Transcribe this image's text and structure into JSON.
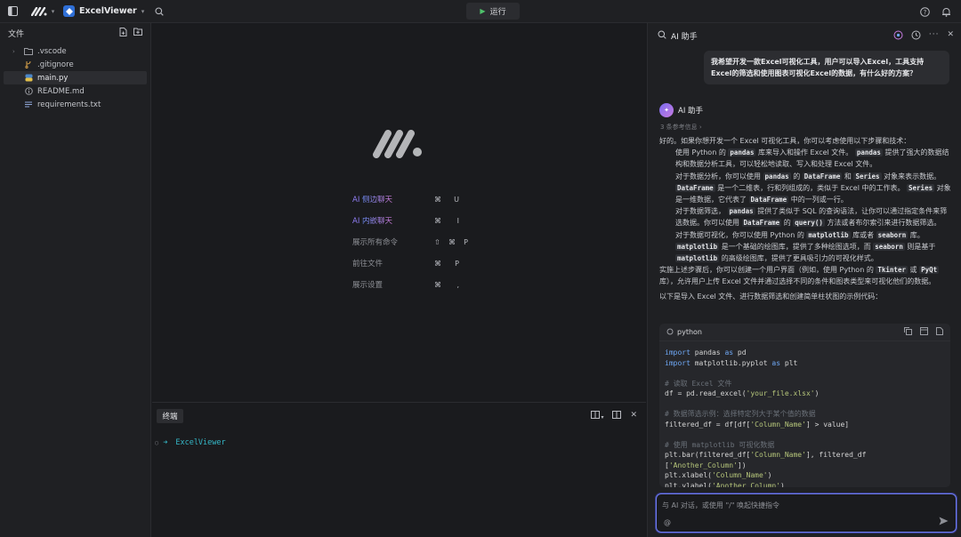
{
  "titlebar": {
    "project": "ExcelViewer",
    "run_label": "运行"
  },
  "sidebar": {
    "title": "文件",
    "items": [
      {
        "label": ".vscode",
        "kind": "folder"
      },
      {
        "label": ".gitignore",
        "kind": "git"
      },
      {
        "label": "main.py",
        "kind": "python",
        "active": true
      },
      {
        "label": "README.md",
        "kind": "info"
      },
      {
        "label": "requirements.txt",
        "kind": "text"
      }
    ]
  },
  "editor": {
    "shortcuts": [
      {
        "prefix": "AI",
        "label": "侧边聊天",
        "k1": "⌘",
        "k2": "U"
      },
      {
        "prefix": "AI",
        "label": "内嵌聊天",
        "k1": "⌘",
        "k2": "I"
      },
      {
        "prefix": "",
        "label": "展示所有命令",
        "k0": "⇧",
        "k1": "⌘",
        "k2": "P"
      },
      {
        "prefix": "",
        "label": "前往文件",
        "k1": "⌘",
        "k2": "P"
      },
      {
        "prefix": "",
        "label": "展示设置",
        "k1": "⌘",
        "k2": ","
      }
    ]
  },
  "terminal": {
    "tab_label": "终端",
    "cwd": "ExcelViewer"
  },
  "ai_panel": {
    "title": "AI 助手",
    "user_message": "我希望开发一款Excel可视化工具，用户可以导入Excel，工具支持Excel的筛选和使用图表可视化Excel的数据，有什么好的方案？",
    "bot_name": "AI 助手",
    "refs": "3 条参考信息 ›",
    "answer_intro": "好的。如果你想开发一个 Excel 可视化工具，你可以考虑使用以下步骤和技术：",
    "step1_a": "使用 Python 的",
    "step1_code": "pandas",
    "step1_b": "库来导入和操作 Excel 文件。",
    "step1_code2": "pandas",
    "step1_c": "提供了强大的数据结构和数据分析工具，可以轻松地读取、写入和处理 Excel 文件。",
    "step2_a": "对于数据分析，你可以使用",
    "step2_code": "pandas",
    "step2_b": "的",
    "step2_code2": "DataFrame",
    "step2_c": "和",
    "step2_code3": "Series",
    "step2_d": "对象来表示数据。",
    "step2_code4": "DataFrame",
    "step2_e": "是一个二维表，行和列组成的，类似于 Excel 中的工作表。",
    "step2_code5": "Series",
    "step2_f": "对象是一维数据，它代表了",
    "step2_code6": "DataFrame",
    "step2_g": "中的一列或一行。",
    "step3_a": "对于数据筛选，",
    "step3_code": "pandas",
    "step3_b": "提供了类似于 SQL 的查询语法，让你可以通过指定条件来筛选数据。你可以使用",
    "step3_code2": "DataFrame",
    "step3_c": "的",
    "step3_code3": "query()",
    "step3_d": "方法或者布尔索引来进行数据筛选。",
    "step4_a": "对于数据可视化，你可以使用 Python 的",
    "step4_code": "matplotlib",
    "step4_b": "库或者",
    "step4_code2": "seaborn",
    "step4_c": "库。",
    "step4_code3": "matplotlib",
    "step4_d": "是一个基础的绘图库，提供了多种绘图选项，而",
    "step4_code4": "seaborn",
    "step4_e": "则是基于",
    "step4_code5": "matplotlib",
    "step4_f": "的高级绘图库，提供了更具吸引力的可视化样式。",
    "step5_a": "实施上述步骤后，你可以创建一个用户界面（例如，使用 Python 的",
    "step5_code": "Tkinter",
    "step5_b": "或",
    "step5_code2": "PyQt",
    "step5_c": "库），允许用户上传 Excel 文件并通过选择不同的条件和图表类型来可视化他们的数据。",
    "code_intro": "以下是导入 Excel 文件、进行数据筛选和创建简单柱状图的示例代码：",
    "code_lang": "python",
    "code_lines": [
      "import pandas as pd",
      "import matplotlib.pyplot as plt",
      "",
      "# 读取 Excel 文件",
      "df = pd.read_excel('your_file.xlsx')",
      "",
      "# 数据筛选示例：选择特定列大于某个值的数据",
      "filtered_df = df[df['Column_Name'] > value]",
      "",
      "# 使用 matplotlib 可视化数据",
      "plt.bar(filtered_df['Column_Name'], filtered_df",
      "['Another_Column'])",
      "plt.xlabel('Column_Name')",
      "plt.ylabel('Another_Column')"
    ],
    "chat_placeholder": "与 AI 对话，或使用 \"/\" 唤起快捷指令",
    "chat_at": "@"
  }
}
